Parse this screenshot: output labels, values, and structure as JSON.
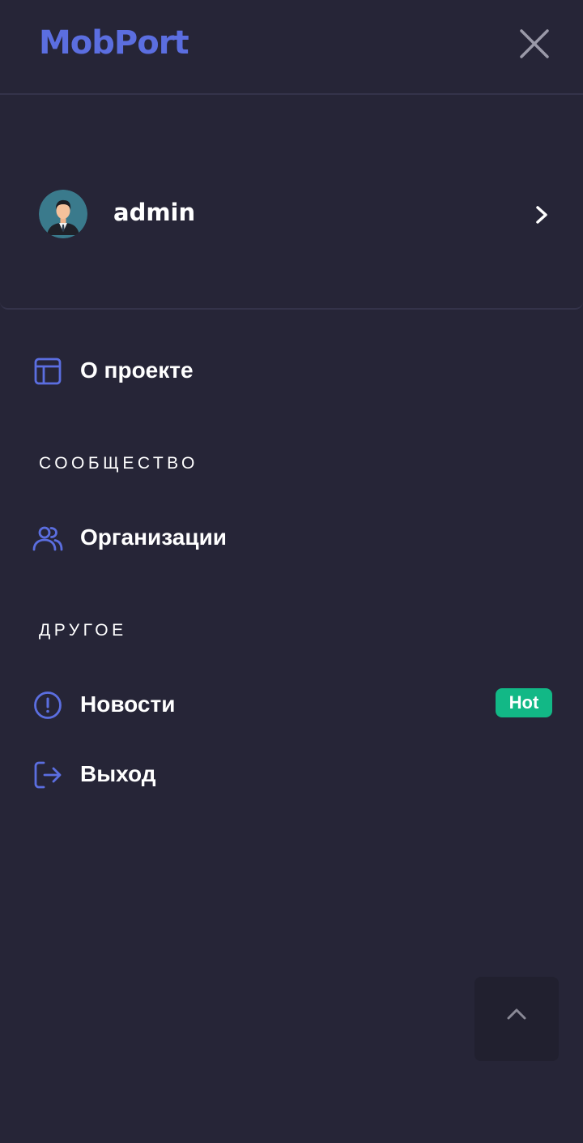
{
  "app": {
    "logo": "MobPort"
  },
  "user": {
    "name": "admin"
  },
  "menu": {
    "about": {
      "label": "О проекте",
      "icon": "layout-icon"
    },
    "community": {
      "title": "СООБЩЕСТВО",
      "items": [
        {
          "label": "Организации",
          "icon": "users-icon"
        }
      ]
    },
    "other": {
      "title": "ДРУГОЕ",
      "items": [
        {
          "label": "Новости",
          "icon": "alert-circle-icon",
          "badge": "Hot"
        },
        {
          "label": "Выход",
          "icon": "logout-icon"
        }
      ]
    }
  },
  "colors": {
    "background": "#262537",
    "accent": "#5b6ee0",
    "badge": "#12b886",
    "divider": "#34334a"
  }
}
